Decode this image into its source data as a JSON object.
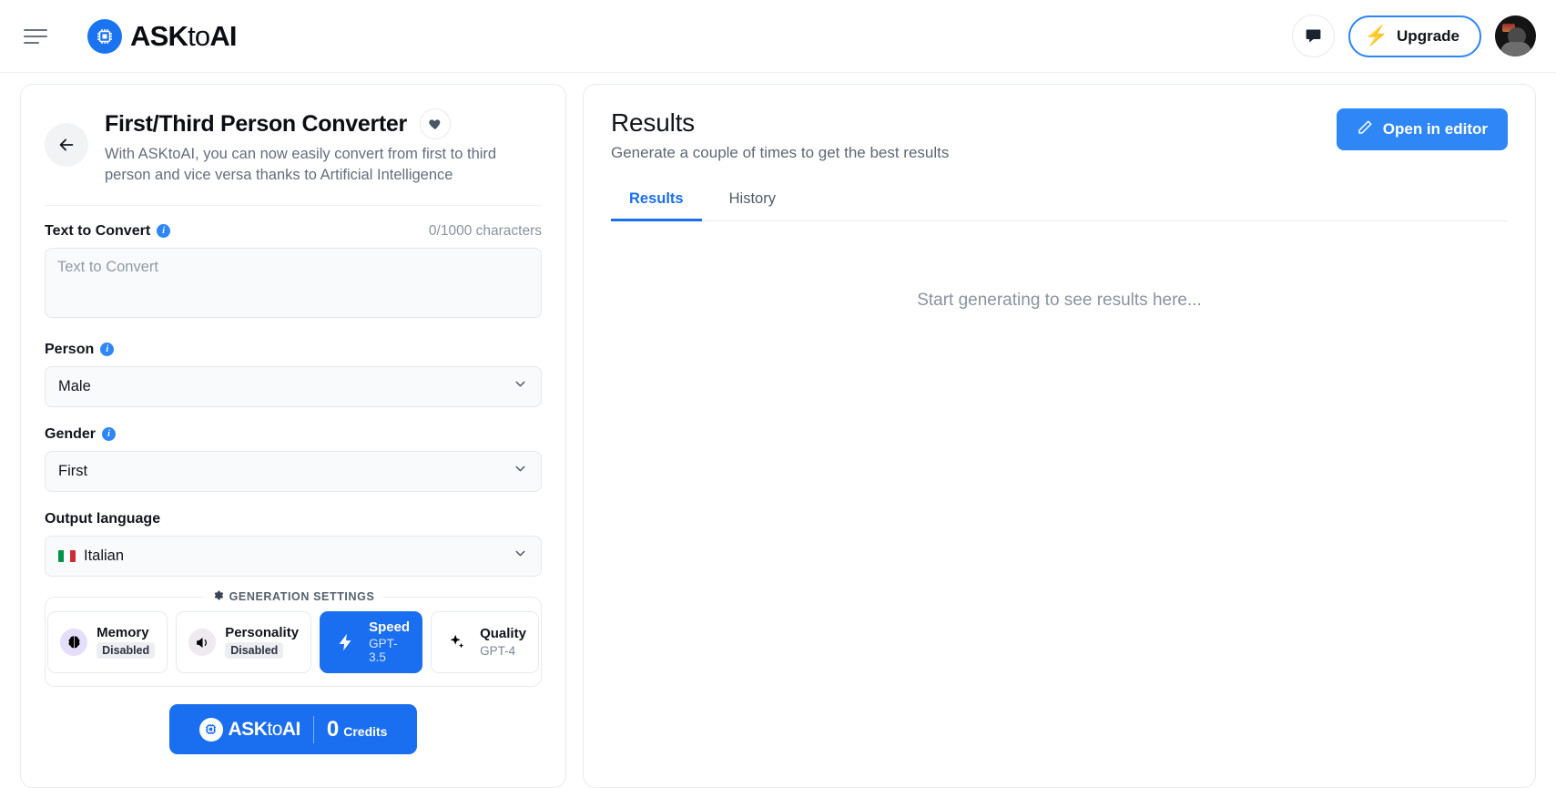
{
  "header": {
    "menu_icon": "hamburger-icon",
    "brand": {
      "prefix": "ASK",
      "mid": "to",
      "suffix": "AI",
      "logo_icon": "cpu-chip-icon"
    },
    "chat_icon": "chat-bubble-icon",
    "upgrade_label": "Upgrade",
    "upgrade_icon": "lightning-bolt-icon",
    "avatar_name": "user-avatar"
  },
  "tool": {
    "back_icon": "arrow-left-icon",
    "title": "First/Third Person Converter",
    "favorite_icon": "heart-icon",
    "description": "With ASKtoAI, you can now easily convert from first to third person and vice versa thanks to Artificial Intelligence",
    "text_field": {
      "label": "Text to Convert",
      "info_icon": "info-icon",
      "counter": "0/1000 characters",
      "value": "",
      "placeholder": "Text to Convert"
    },
    "person_field": {
      "label": "Person",
      "info_icon": "info-icon",
      "value": "Male",
      "chevron_icon": "chevron-down-icon"
    },
    "gender_field": {
      "label": "Gender",
      "info_icon": "info-icon",
      "value": "First",
      "chevron_icon": "chevron-down-icon"
    },
    "language_field": {
      "label": "Output language",
      "value": "Italian",
      "flag": "italy-flag-icon",
      "chevron_icon": "chevron-down-icon"
    },
    "generation_settings": {
      "legend": "GENERATION SETTINGS",
      "legend_icon": "gear-icon",
      "chips": [
        {
          "name": "Memory",
          "status": "Disabled",
          "icon": "brain-icon",
          "active": false
        },
        {
          "name": "Personality",
          "status": "Disabled",
          "icon": "megaphone-icon",
          "active": false
        },
        {
          "name": "Speed",
          "status": "GPT-3.5",
          "icon": "lightning-bolt-icon",
          "active": true
        },
        {
          "name": "Quality",
          "status": "GPT-4",
          "icon": "sparkles-icon",
          "active": false
        }
      ]
    },
    "credits": {
      "brand_prefix": "ASK",
      "brand_mid": "to",
      "brand_suffix": "AI",
      "amount": "0",
      "unit": "Credits",
      "logo_icon": "cpu-chip-icon"
    }
  },
  "results": {
    "title": "Results",
    "subtitle": "Generate a couple of times to get the best results",
    "open_editor_label": "Open in editor",
    "open_editor_icon": "pencil-icon",
    "tabs": [
      {
        "label": "Results",
        "active": true
      },
      {
        "label": "History",
        "active": false
      }
    ],
    "empty_text": "Start generating to see results here..."
  },
  "colors": {
    "accent": "#1a6ef0",
    "accent_light": "#2f86f6",
    "bolt": "#fcc21b",
    "muted": "#8a93a1"
  }
}
